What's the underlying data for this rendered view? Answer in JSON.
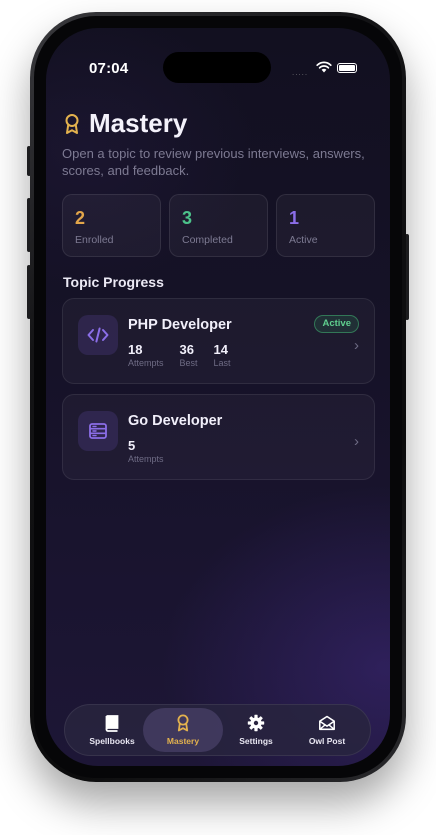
{
  "status_bar": {
    "time": "07:04",
    "signal": "....."
  },
  "header": {
    "title": "Mastery",
    "subtitle": "Open a topic to review previous interviews, answers, scores, and feedback."
  },
  "stats": [
    {
      "value": "2",
      "label": "Enrolled",
      "color": "#e3a64a"
    },
    {
      "value": "3",
      "label": "Completed",
      "color": "#4cc28a"
    },
    {
      "value": "1",
      "label": "Active",
      "color": "#8b6ee8"
    }
  ],
  "section_title": "Topic Progress",
  "topics": [
    {
      "name": "PHP Developer",
      "icon": "code-icon",
      "badge": "Active",
      "metrics": [
        {
          "value": "18",
          "label": "Attempts"
        },
        {
          "value": "36",
          "label": "Best"
        },
        {
          "value": "14",
          "label": "Last"
        }
      ]
    },
    {
      "name": "Go Developer",
      "icon": "server-icon",
      "metrics": [
        {
          "value": "5",
          "label": "Attempts"
        }
      ]
    }
  ],
  "tabs": [
    {
      "label": "Spellbooks",
      "icon": "book-icon"
    },
    {
      "label": "Mastery",
      "icon": "award-icon",
      "active": true
    },
    {
      "label": "Settings",
      "icon": "gear-icon"
    },
    {
      "label": "Owl Post",
      "icon": "envelope-icon"
    }
  ],
  "colors": {
    "accent": "#e3b24e",
    "active_badge": "#5fcf8e",
    "icon_purple": "#8b6ee8"
  }
}
